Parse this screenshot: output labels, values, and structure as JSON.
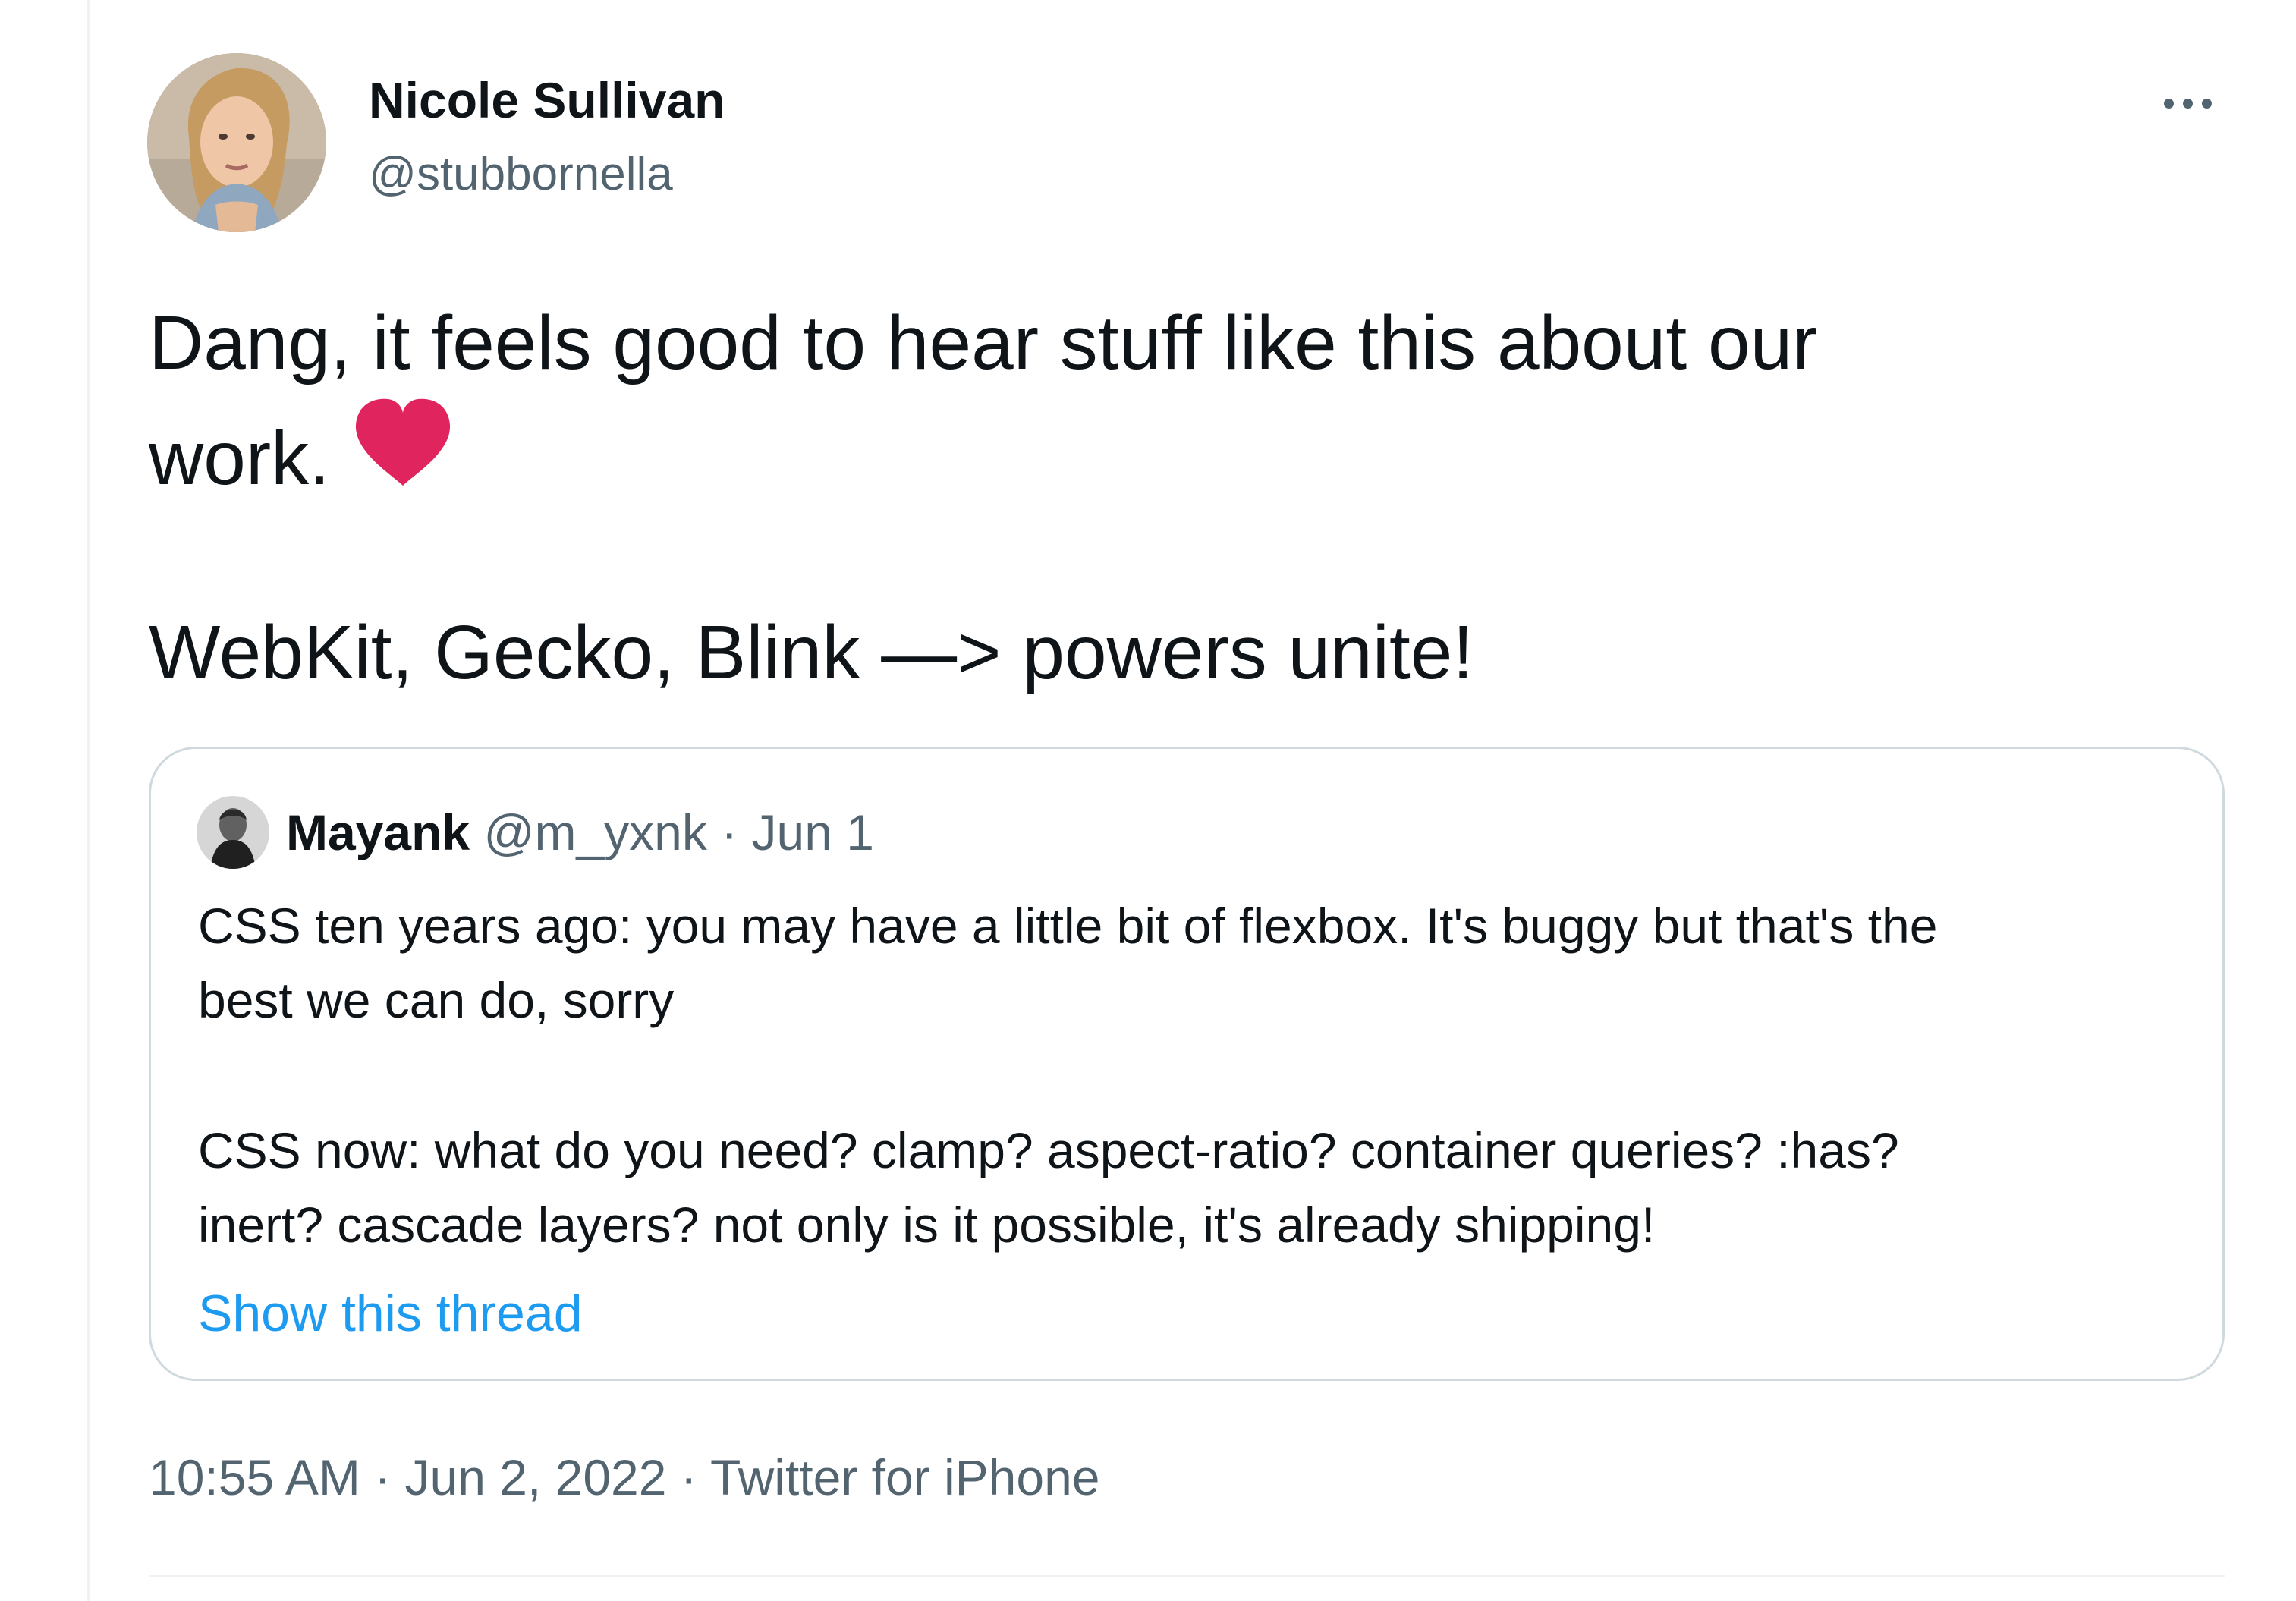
{
  "tweet": {
    "author": {
      "name": "Nicole Sullivan",
      "handle": "@stubbornella"
    },
    "text_lines": [
      "Dang, it feels good to hear stuff like this about our",
      "work.",
      "WebKit, Gecko, Blink —> powers unite!"
    ],
    "emoji": "heart-icon",
    "quoted": {
      "name": "Mayank",
      "handle": "@m_yxnk",
      "separator": " · ",
      "date": "Jun 1",
      "text_lines": [
        "CSS ten years ago: you may have a little bit of flexbox. It's buggy but that's the",
        "best we can do, sorry",
        "CSS now: what do you need? clamp? aspect-ratio? container queries? :has?",
        "inert? cascade layers? not only is it possible, it's already shipping!"
      ],
      "show_thread": "Show this thread"
    },
    "meta": {
      "time": "10:55 AM",
      "date": "Jun 2, 2022",
      "source": "Twitter for iPhone",
      "separator": " · "
    }
  },
  "colors": {
    "text_primary": "#0f1419",
    "text_secondary": "#536471",
    "link": "#1d9bf0",
    "border": "#cfd9de",
    "heart": "#e0245e"
  }
}
